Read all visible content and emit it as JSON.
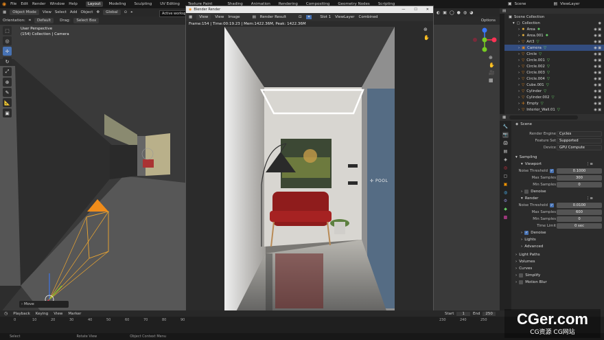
{
  "menubar": {
    "menus": [
      "File",
      "Edit",
      "Render",
      "Window",
      "Help"
    ],
    "workspaces": [
      "Layout",
      "Modeling",
      "Sculpting",
      "UV Editing",
      "Texture Paint"
    ],
    "active_workspace": "Layout",
    "hidden_tabs": [
      "Shading",
      "Animation",
      "Rendering",
      "Compositing",
      "Geometry Nodes",
      "Scripting"
    ],
    "scene_label": "Scene",
    "viewlayer_label": "ViewLayer"
  },
  "viewport_header": {
    "mode": "Object Mode",
    "items": [
      "View",
      "Select",
      "Add",
      "Object"
    ],
    "transform": "Global",
    "tooltip": "Active workspace"
  },
  "viewport_subheader": {
    "orientation_label": "Orientation:",
    "orientation_value": "Default",
    "drag_label": "Drag:",
    "drag_value": "Select Box"
  },
  "viewport": {
    "perspective": "User Perspective",
    "collection": "(154) Collection | Camera",
    "options": "Options",
    "tools": [
      "select-box",
      "cursor",
      "move",
      "rotate",
      "scale",
      "transform",
      "annotate",
      "measure",
      "add-cube"
    ],
    "operator_panel": "Move"
  },
  "render_window": {
    "title": "Blender Render",
    "menu": [
      "View",
      "View",
      "Image"
    ],
    "result": "Render Result",
    "slot": "Slot 1",
    "viewlayer": "ViewLayer",
    "pass": "Combined",
    "info": "Frame:154 | Time:00:19.23 | Mem:1422.36M, Peak: 1422.36M",
    "wall_text": "POOL"
  },
  "outliner": {
    "scene_collection": "Scene Collection",
    "collection": "Collection",
    "items": [
      {
        "name": "Area",
        "type": "light"
      },
      {
        "name": "Area.001",
        "type": "light"
      },
      {
        "name": "Art3",
        "type": "mesh"
      },
      {
        "name": "Camera",
        "type": "camera",
        "selected": true
      },
      {
        "name": "Circle",
        "type": "mesh"
      },
      {
        "name": "Circle.001",
        "type": "mesh"
      },
      {
        "name": "Circle.002",
        "type": "mesh"
      },
      {
        "name": "Circle.003",
        "type": "mesh"
      },
      {
        "name": "Circle.004",
        "type": "mesh"
      },
      {
        "name": "Cube.001",
        "type": "mesh"
      },
      {
        "name": "Cylinder",
        "type": "mesh"
      },
      {
        "name": "Cylinder.002",
        "type": "mesh"
      },
      {
        "name": "Empty",
        "type": "empty"
      },
      {
        "name": "Interior_Wall.01",
        "type": "mesh"
      }
    ]
  },
  "properties": {
    "breadcrumb": "Scene",
    "render_engine_label": "Render Engine",
    "render_engine": "Cycles",
    "feature_set_label": "Feature Set",
    "feature_set": "Supported",
    "device_label": "Device",
    "device": "GPU Compute",
    "sampling": "Sampling",
    "viewport": "Viewport",
    "noise_threshold_label": "Noise Threshold",
    "viewport_noise_threshold": "0.1000",
    "max_samples_label": "Max Samples",
    "viewport_max_samples": "300",
    "min_samples_label": "Min Samples",
    "viewport_min_samples": "0",
    "denoise": "Denoise",
    "render": "Render",
    "render_noise_threshold": "0.0100",
    "render_max_samples": "600",
    "render_min_samples": "0",
    "time_limit_label": "Time Limit",
    "time_limit": "0 sec",
    "lights": "Lights",
    "advanced": "Advanced",
    "light_paths": "Light Paths",
    "volumes": "Volumes",
    "curves": "Curves",
    "simplify": "Simplify",
    "motion_blur": "Motion Blur"
  },
  "timeline": {
    "menu": [
      "Playback",
      "Keying",
      "View",
      "Marker"
    ],
    "frames": [
      "0",
      "10",
      "20",
      "30",
      "40",
      "50",
      "60",
      "70",
      "80",
      "90"
    ],
    "right_frames": [
      "230",
      "240",
      "250"
    ],
    "start_label": "Start",
    "start": "1",
    "end_label": "End",
    "end": "250"
  },
  "statusbar": {
    "items": [
      "Select",
      "Rotate View",
      "Object Context Menu"
    ]
  },
  "watermark": {
    "main": "CGer.com",
    "sub": "CG资源 CG网站"
  },
  "colors": {
    "accent": "#4772b3",
    "selected_row": "#334d80",
    "camera_orange": "#f08c1a"
  }
}
